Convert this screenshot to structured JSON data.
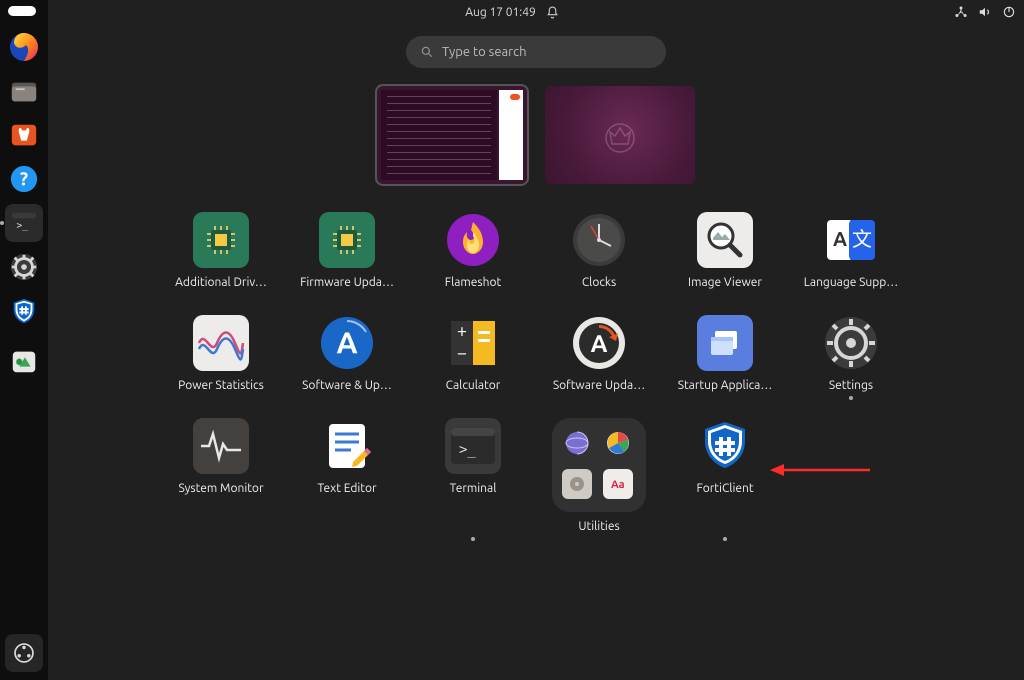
{
  "topbar": {
    "datetime": "Aug 17  01:49"
  },
  "search": {
    "placeholder": "Type to search"
  },
  "dock": {
    "items": [
      {
        "name": "firefox",
        "running": false
      },
      {
        "name": "files",
        "running": false
      },
      {
        "name": "software-store",
        "running": false
      },
      {
        "name": "help",
        "running": false
      },
      {
        "name": "terminal",
        "running": true
      },
      {
        "name": "settings",
        "running": false
      },
      {
        "name": "forticlient",
        "running": false
      },
      {
        "name": "trash",
        "running": false
      }
    ]
  },
  "apps": [
    {
      "id": "additional-drivers",
      "label": "Additional Driv…"
    },
    {
      "id": "firmware-updater",
      "label": "Firmware Upda…"
    },
    {
      "id": "flameshot",
      "label": "Flameshot"
    },
    {
      "id": "clocks",
      "label": "Clocks"
    },
    {
      "id": "image-viewer",
      "label": "Image Viewer"
    },
    {
      "id": "language-support",
      "label": "Language Supp…"
    },
    {
      "id": "power-statistics",
      "label": "Power Statistics"
    },
    {
      "id": "software-updates",
      "label": "Software & Up…"
    },
    {
      "id": "calculator",
      "label": "Calculator"
    },
    {
      "id": "software-updater",
      "label": "Software Upda…"
    },
    {
      "id": "startup-applications",
      "label": "Startup Applica…"
    },
    {
      "id": "settings",
      "label": "Settings",
      "running": true
    },
    {
      "id": "system-monitor",
      "label": "System Monitor"
    },
    {
      "id": "text-editor",
      "label": "Text Editor"
    },
    {
      "id": "terminal",
      "label": "Terminal",
      "running": true
    },
    {
      "id": "utilities-folder",
      "label": "Utilities",
      "folder": true
    },
    {
      "id": "forticlient",
      "label": "FortiClient",
      "running": true
    }
  ],
  "utilities_folder": {
    "items": [
      "network",
      "disk-usage",
      "disks",
      "characters"
    ]
  }
}
